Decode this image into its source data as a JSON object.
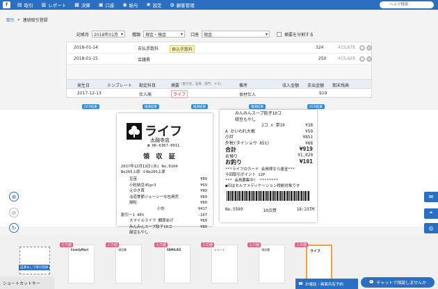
{
  "topbar": {
    "logo_letter": "f",
    "nav": [
      {
        "icon": "book-icon",
        "glyph": "▤",
        "label": "取引"
      },
      {
        "icon": "chart-icon",
        "glyph": "▥",
        "label": "レポート"
      },
      {
        "icon": "calculator-icon",
        "glyph": "▦",
        "label": "決算"
      },
      {
        "icon": "bank-icon",
        "glyph": "▣",
        "label": "口座"
      },
      {
        "icon": "person-icon",
        "glyph": "◉",
        "label": "給与"
      },
      {
        "icon": "gear-icon",
        "glyph": "✱",
        "label": "設定"
      },
      {
        "icon": "people-icon",
        "glyph": "◍",
        "label": "顧客管理"
      }
    ],
    "search_placeholder": "ヘルプ検索"
  },
  "breadcrumb": {
    "link": "取引",
    "separator": "»",
    "current": "連続取引登録"
  },
  "form": {
    "period_label": "記帳月",
    "period_value": "2018年01月",
    "type_label": "種類",
    "type_value": "現金・預金",
    "account_label": "口座",
    "account_value": "現金",
    "split_label": "摘要を分割する"
  },
  "existing_rows": [
    {
      "date": "2018-01-14",
      "subject": "支払手数料",
      "tag": "振込手数料",
      "amount": "324",
      "balance": "415,678"
    },
    {
      "date": "2018-01-15",
      "subject": "会議費",
      "tag": "",
      "amount": "250",
      "balance": "415,428"
    }
  ],
  "columns": [
    "発生日",
    "テンプレート",
    "勘定科目",
    "摘要",
    "(取引先、品目、部門、メモ)",
    "備考",
    "収入金額",
    "支出金額",
    "期末残高"
  ],
  "entry": {
    "date": "2017-12-13",
    "subject": "仕入高",
    "tag": "ライフ",
    "memo": "食材仕入",
    "expense": "919"
  },
  "ocr_badges": [
    "OCR結果",
    "推測結果",
    "推測結果",
    "推測結果",
    "OCR結果"
  ],
  "receipt_left": {
    "brand": "ライフ",
    "store": "太融寺店",
    "tel": "☎ 06-6367-0011",
    "title": "領 収 証",
    "date_line": "2017年12月13日(水)    No.0104",
    "reg_line": "No205上原       ※No205上原",
    "items": [
      {
        "name": "豆苗",
        "price": "¥89"
      },
      {
        "name": "小粒納豆45g×3",
        "price": "¥69"
      },
      {
        "name": "えのき茸",
        "price": "¥89"
      },
      {
        "name": "淡道季節ジューシーな包焼売",
        "price": "¥89"
      },
      {
        "name": "緑粒",
        "price": "¥89"
      },
      {
        "name": "小計",
        "price": "¥417"
      },
      {
        "name": "割引ー1    40%",
        "price": "-167"
      },
      {
        "name": "スマイルライフ  鯛厚あげ",
        "price": "¥89"
      },
      {
        "name": "みんみんスープ餃子10コ",
        "price": "¥89"
      },
      {
        "name": "緑豆もやし",
        "price": ""
      }
    ]
  },
  "receipt_right": {
    "top_lines": [
      {
        "name": "みんみんスープ餃子10コ",
        "price": ""
      },
      {
        "name": "緑豆もやし",
        "price": ""
      },
      {
        "name": "2コ x 単19",
        "price": "¥38"
      },
      {
        "name": "A かいわれ大根",
        "price": "¥59"
      },
      {
        "name": "小計",
        "price": "¥851"
      },
      {
        "name": "外税(タイショウ    851)",
        "price": "¥68"
      }
    ],
    "total_label": "合計",
    "total_value": "¥919",
    "paid_label": "お預り",
    "paid_value": "¥1,020",
    "change_label": "お釣り",
    "change_value": "¥101",
    "notes": [
      "***ライフのカード 会員様なら進呈***",
      "今回取引ポイント          12P",
      "***  会員募集中！  ********",
      "●印はセルフメディケーション税制対象です"
    ],
    "footer_no": "No.5599",
    "footer_count": "10点買",
    "footer_time": "18:23TM"
  },
  "thumbs": {
    "badge": "えの値",
    "new_label": "証憑なしで取引登録",
    "labels": [
      "FamilyMart",
      "領収書",
      "FAMILIES",
      "レシート",
      "領収書",
      "領収書",
      "ライフ"
    ]
  },
  "bottom": {
    "shortcut": "ショートカットキー",
    "help": "お電話・画面共有予約",
    "chat": "チャットで相談しませんか"
  },
  "colors": {
    "brand": "#2a6fc2",
    "badge": "#f05a8a"
  }
}
